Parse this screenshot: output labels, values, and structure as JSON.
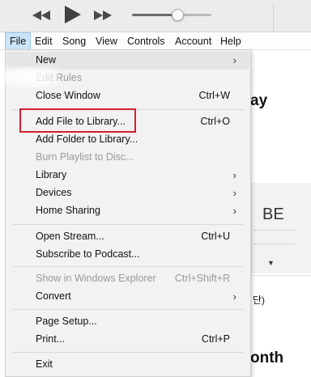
{
  "player": {
    "volume_fraction": 0.56
  },
  "menubar": {
    "items": [
      {
        "label": "File"
      },
      {
        "label": "Edit"
      },
      {
        "label": "Song"
      },
      {
        "label": "View"
      },
      {
        "label": "Controls"
      },
      {
        "label": "Account"
      },
      {
        "label": "Help"
      }
    ]
  },
  "background": {
    "heading_1": "ay",
    "heading_2": "onth",
    "album_logo": "BE",
    "album_small": "▼",
    "korean_snippet": "단)",
    "parenthesis": "("
  },
  "file_menu": {
    "items": [
      {
        "label": "New",
        "key": "",
        "submenu": true,
        "disabled": false
      },
      {
        "label": "Edit Rules",
        "key": "",
        "submenu": false,
        "disabled": true
      },
      {
        "label": "Close Window",
        "key": "Ctrl+W",
        "submenu": false,
        "disabled": false
      },
      {
        "label": "Add File to Library...",
        "key": "Ctrl+O",
        "submenu": false,
        "disabled": false
      },
      {
        "label": "Add Folder to Library...",
        "key": "",
        "submenu": false,
        "disabled": false
      },
      {
        "label": "Burn Playlist to Disc...",
        "key": "",
        "submenu": false,
        "disabled": true
      },
      {
        "label": "Library",
        "key": "",
        "submenu": true,
        "disabled": false
      },
      {
        "label": "Devices",
        "key": "",
        "submenu": true,
        "disabled": false
      },
      {
        "label": "Home Sharing",
        "key": "",
        "submenu": true,
        "disabled": false
      },
      {
        "label": "Open Stream...",
        "key": "Ctrl+U",
        "submenu": false,
        "disabled": false
      },
      {
        "label": "Subscribe to Podcast...",
        "key": "",
        "submenu": false,
        "disabled": false
      },
      {
        "label": "Show in Windows Explorer",
        "key": "Ctrl+Shift+R",
        "submenu": false,
        "disabled": true
      },
      {
        "label": "Convert",
        "key": "",
        "submenu": true,
        "disabled": false
      },
      {
        "label": "Page Setup...",
        "key": "",
        "submenu": false,
        "disabled": false
      },
      {
        "label": "Print...",
        "key": "Ctrl+P",
        "submenu": false,
        "disabled": false
      },
      {
        "label": "Exit",
        "key": "",
        "submenu": false,
        "disabled": false
      }
    ],
    "submenu_arrow": "›"
  },
  "colors": {
    "highlight_box": "#d01f2e",
    "menubar_active": "#cce4f7"
  }
}
